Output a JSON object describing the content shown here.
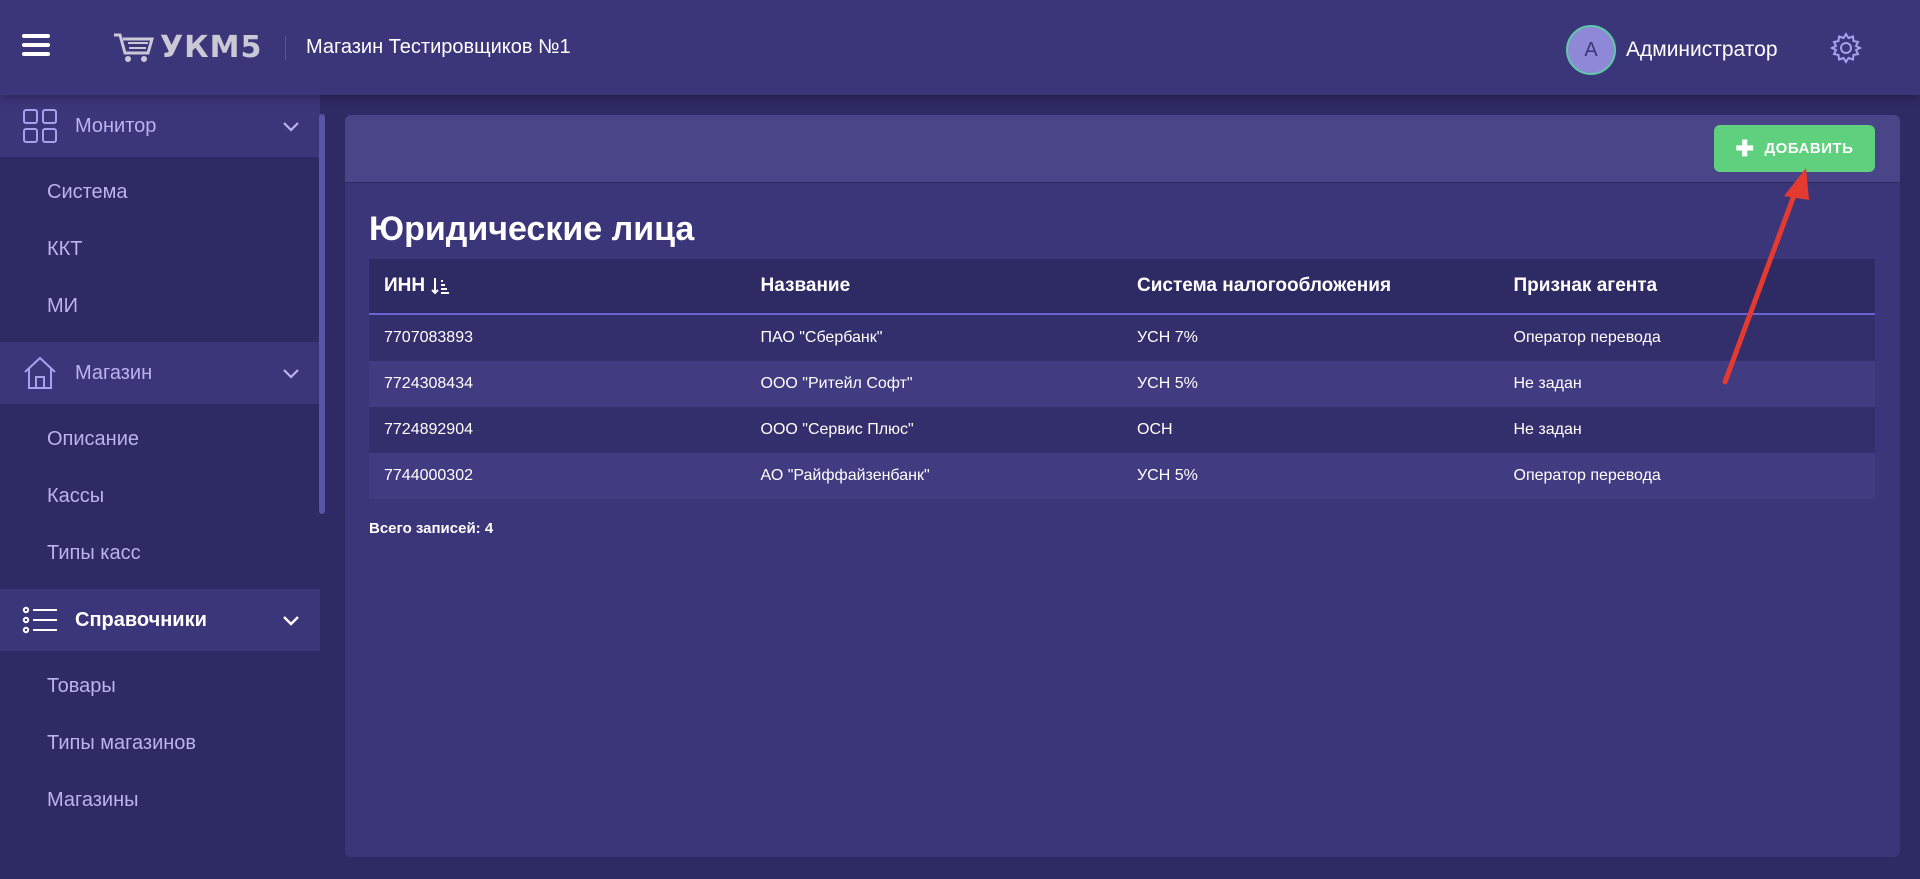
{
  "header": {
    "logo_text": "УКМ5",
    "store_name": "Магазин Тестировщиков №1",
    "avatar_letter": "А",
    "user_name": "Администратор"
  },
  "sidebar": {
    "sections": [
      {
        "label": "Монитор",
        "items": [
          "Система",
          "ККТ",
          "МИ"
        ]
      },
      {
        "label": "Магазин",
        "items": [
          "Описание",
          "Кассы",
          "Типы касс"
        ]
      },
      {
        "label": "Справочники",
        "items": [
          "Товары",
          "Типы магазинов",
          "Магазины"
        ]
      }
    ]
  },
  "main": {
    "add_button": "ДОБАВИТЬ",
    "title": "Юридические лица",
    "columns": [
      "ИНН",
      "Название",
      "Система налогообложения",
      "Признак агента"
    ],
    "rows": [
      [
        "7707083893",
        "ПАО \"Сбербанк\"",
        "УСН 7%",
        "Оператор перевода"
      ],
      [
        "7724308434",
        "ООО \"Ритейл Софт\"",
        "УСН 5%",
        "Не задан"
      ],
      [
        "7724892904",
        "ООО \"Сервис Плюс\"",
        "ОСН",
        "Не задан"
      ],
      [
        "7744000302",
        "АО \"Райффайзенбанк\"",
        "УСН 5%",
        "Оператор перевода"
      ]
    ],
    "total_label": "Всего записей: 4"
  },
  "colors": {
    "accent_green": "#5fd17e",
    "header_bg": "#3b357a",
    "annotation_red": "#e53a2f"
  },
  "icons": [
    "menu-icon",
    "cart-icon",
    "gear-icon",
    "grid-icon",
    "home-icon",
    "list-icon",
    "chevron-down-icon",
    "plus-icon",
    "sort-icon"
  ]
}
